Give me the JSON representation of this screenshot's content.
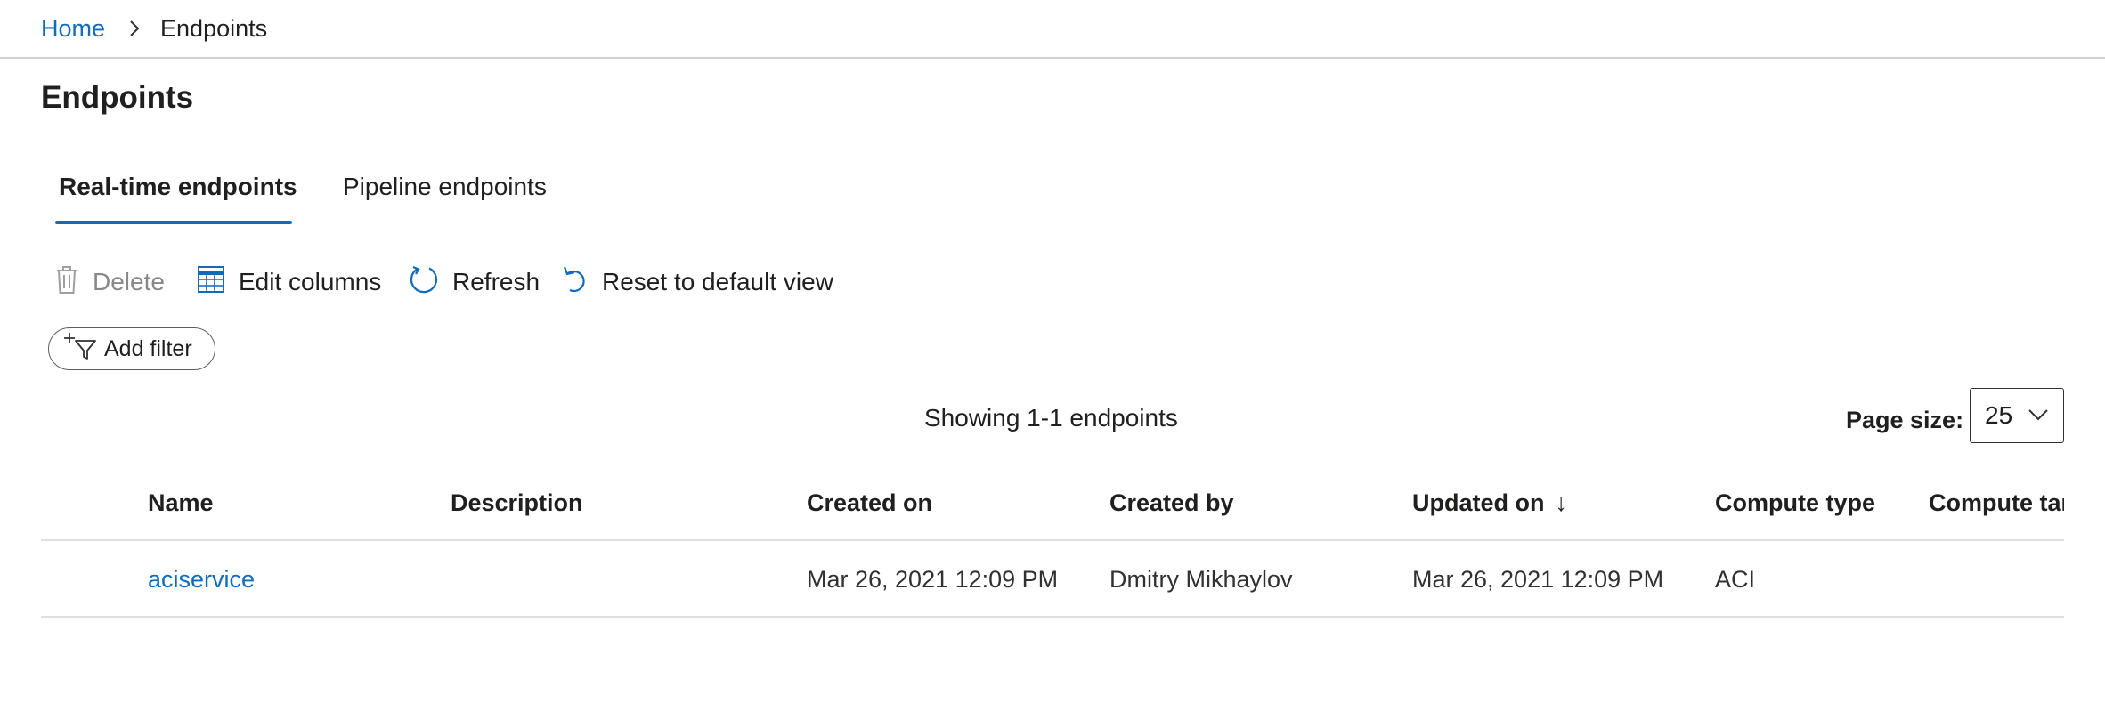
{
  "breadcrumb": {
    "home": "Home",
    "current": "Endpoints"
  },
  "page": {
    "title": "Endpoints"
  },
  "tabs": [
    {
      "label": "Real-time endpoints",
      "active": true
    },
    {
      "label": "Pipeline endpoints",
      "active": false
    }
  ],
  "toolbar": {
    "delete_label": "Delete",
    "edit_columns_label": "Edit columns",
    "refresh_label": "Refresh",
    "reset_label": "Reset to default view"
  },
  "filter": {
    "add_filter_label": "Add filter"
  },
  "status": {
    "showing_text": "Showing 1-1 endpoints",
    "page_size_label": "Page size:",
    "page_size_value": "25"
  },
  "table": {
    "columns": [
      "Name",
      "Description",
      "Created on",
      "Created by",
      "Updated on",
      "Compute type",
      "Compute tar"
    ],
    "sort_indicator": "↓",
    "rows": [
      {
        "name": "aciservice",
        "description": "",
        "created_on": "Mar 26, 2021 12:09 PM",
        "created_by": "Dmitry Mikhaylov",
        "updated_on": "Mar 26, 2021 12:09 PM",
        "compute_type": "ACI",
        "compute_target": ""
      }
    ]
  },
  "colors": {
    "accent": "#0f6cbd",
    "text": "#201f1e",
    "disabled": "#8a8886",
    "divider": "#e1dfdd"
  }
}
